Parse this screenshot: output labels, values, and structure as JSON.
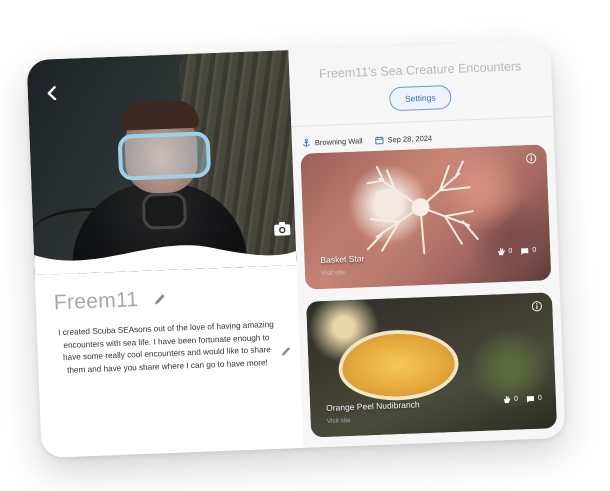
{
  "profile": {
    "username": "Freem11",
    "bio": "I created Scuba SEAsons out of the love of having amazing encounters with sea life. I have been fortunate enough to have some really cool encounters and would like to share them and have you share where I can go to have more!"
  },
  "header": {
    "title": "Freem11's Sea Creature Encounters",
    "settings_label": "Settings"
  },
  "filters": {
    "location": "Browning Wall",
    "date": "Sep 28, 2024"
  },
  "cards": [
    {
      "title": "Basket Star",
      "subtitle": "Visit site",
      "likes": "0",
      "comments": "0"
    },
    {
      "title": "Orange Peel Nudibranch",
      "subtitle": "Visit site",
      "likes": "0",
      "comments": "0"
    }
  ],
  "colors": {
    "accent": "#3a6fc0",
    "title_gray": "#b8b8b8"
  },
  "icons": {
    "back": "chevron-left-icon",
    "camera": "camera-icon",
    "edit": "pencil-icon",
    "anchor": "anchor-icon",
    "calendar": "calendar-icon",
    "like": "hand-icon",
    "comment": "comment-icon",
    "info": "info-icon"
  }
}
